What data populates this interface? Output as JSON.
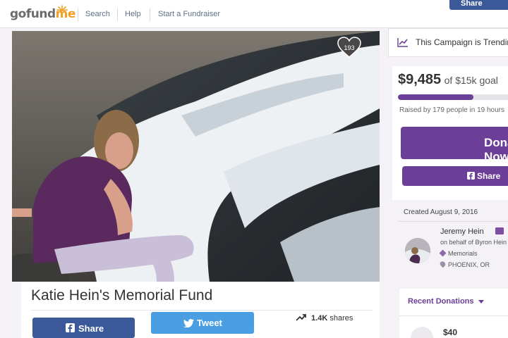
{
  "nav": {
    "logo_go": "go",
    "logo_fund": "fund",
    "logo_me": "me",
    "links": [
      "Search",
      "Help",
      "Start a Fundraiser"
    ],
    "top_share_label": "Share"
  },
  "campaign": {
    "heart_count": "193",
    "title": "Katie Hein's Memorial Fund",
    "facebook_share_label": "Share",
    "tweet_label": "Tweet",
    "shares_count": "1.4K",
    "shares_label": "shares"
  },
  "sidebar": {
    "trending_text": "This Campaign is Trending",
    "raised_amount": "$9,485",
    "goal_text": "of $15k goal",
    "progress_fraction": 0.63,
    "raised_by": "Raised by 179 people in 19 hours",
    "donate_label": "Donate Now",
    "share_label": "Share",
    "created": "Created August 9, 2016",
    "organizer_name": "Jeremy Hein",
    "on_behalf": "on behalf of Byron Hein",
    "category": "Memorials",
    "location": "PHOENIX, OR",
    "recent_donations_label": "Recent Donations",
    "recent_donation_amount": "$40"
  },
  "colors": {
    "brand_purple": "#6b3e97",
    "facebook_blue": "#3b5998",
    "twitter_blue": "#4b9ee2",
    "logo_orange": "#f2a023"
  }
}
